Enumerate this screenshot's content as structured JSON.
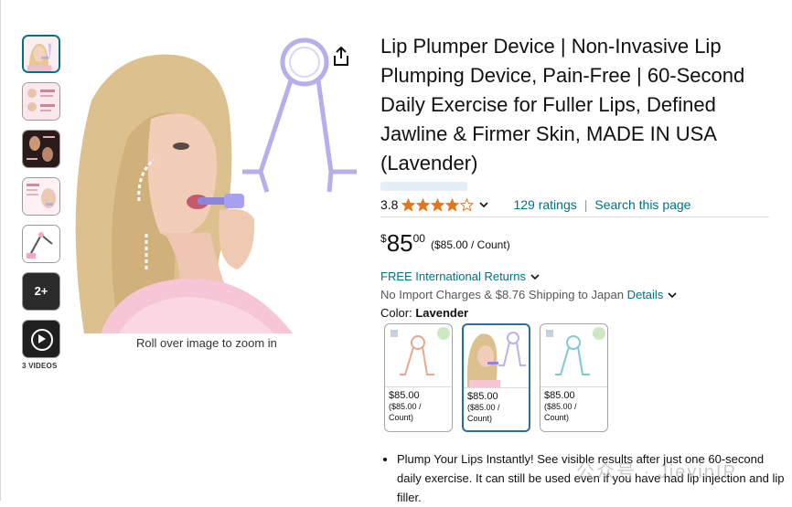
{
  "gallery": {
    "more_count": "2+",
    "videos_label": "3 VIDEOS",
    "zoom_hint": "Roll over image to zoom in"
  },
  "product": {
    "title": "Lip Plumper Device | Non-Invasive Lip Plumping Device, Pain-Free | 60-Second Daily Exercise for Fuller Lips, Defined Jawline & Firmer Skin, MADE IN USA (Lavender)",
    "rating_value": "3.8",
    "rating": 3.8,
    "ratings_count": "129 ratings",
    "search_link": "Search this page",
    "separator": "|"
  },
  "price": {
    "currency": "$",
    "whole": "85",
    "fraction": "00",
    "per_unit": "($85.00 / Count)"
  },
  "shipping": {
    "returns": "FREE International Returns",
    "import_text": "No Import Charges & $8.76 Shipping to Japan",
    "details_link": "Details"
  },
  "color": {
    "label": "Color:",
    "selected": "Lavender"
  },
  "swatches": [
    {
      "price": "$85.00",
      "unit": "($85.00 / Count)",
      "tint": "#e8a890"
    },
    {
      "price": "$85.00",
      "unit": "($85.00 / Count)",
      "tint": "#b9b3ea"
    },
    {
      "price": "$85.00",
      "unit": "($85.00 / Count)",
      "tint": "#7fc9d6"
    }
  ],
  "bullets": [
    "Plump Your Lips Instantly! See visible results after just one 60-second daily exercise. It can still be used even if you have had lip injection and lip filler."
  ],
  "watermark": "公众号 · JievinIP",
  "colors": {
    "link": "#007185",
    "star": "#de7921",
    "selected_border": "#2f6c9f",
    "device": "#b5b0ec"
  },
  "icons": {
    "share": "share-icon",
    "chevron": "chevron-down-icon",
    "play": "play-icon",
    "star": "star-icon"
  }
}
